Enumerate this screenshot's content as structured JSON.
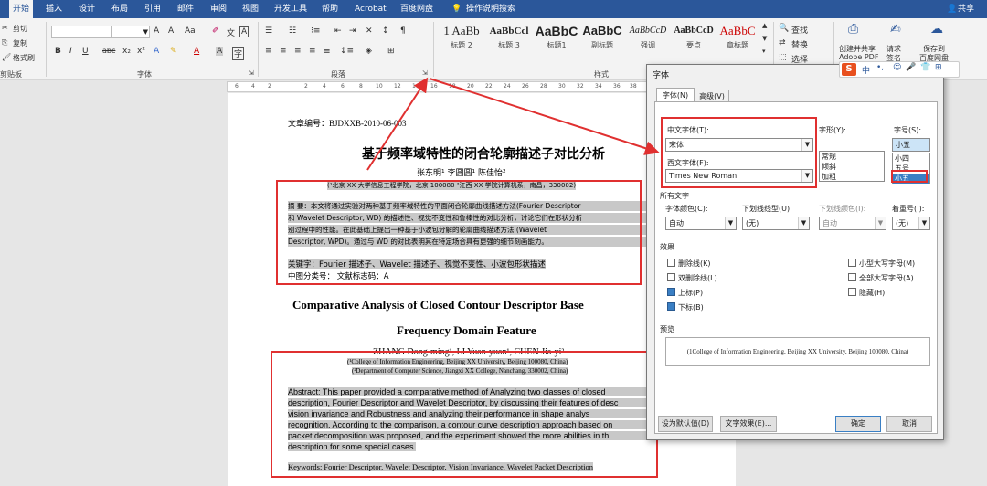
{
  "tabs": [
    "开始",
    "插入",
    "设计",
    "布局",
    "引用",
    "邮件",
    "审阅",
    "视图",
    "开发工具",
    "帮助",
    "Acrobat",
    "百度网盘"
  ],
  "tell_me": "操作说明搜索",
  "share": "共享",
  "clipboard": {
    "cut": "剪切",
    "copy": "复制",
    "format_painter": "格式刷",
    "label": "剪贴板"
  },
  "font_group": {
    "label": "字体",
    "bold": "B",
    "italic": "I",
    "underline": "U",
    "strike": "abc",
    "sub": "x₂",
    "sup": "x²",
    "font_color": "A",
    "clear": "A",
    "case": "Aa",
    "grow": "A",
    "shrink": "A"
  },
  "paragraph_group": {
    "label": "段落"
  },
  "styles_group": {
    "label": "样式",
    "items": [
      {
        "preview": "1 AaBb",
        "name": "标题 2"
      },
      {
        "preview": "AaBbCcl",
        "name": "标题 3"
      },
      {
        "preview": "AaBbC",
        "name": "标题1"
      },
      {
        "preview": "AaBbC",
        "name": "副标题"
      },
      {
        "preview": "AaBbCcD",
        "name": "强调"
      },
      {
        "preview": "AaBbCcD",
        "name": "要点"
      },
      {
        "preview": "AaBbC",
        "name": "章标题"
      }
    ]
  },
  "editing": {
    "find": "查找",
    "replace": "替换",
    "select": "选择"
  },
  "adobe": {
    "create_share": "创建并共享",
    "adobe_pdf": "Adobe PDF",
    "request_sign": "请求",
    "sign": "签名",
    "save_to": "保存到",
    "baidu": "百度网盘"
  },
  "ruler_ticks": [
    "6",
    "4",
    "2",
    "",
    "2",
    "4",
    "6",
    "8",
    "10",
    "12",
    "14",
    "16",
    "18",
    "20",
    "22",
    "24",
    "26",
    "28",
    "30",
    "32",
    "34",
    "36",
    "38",
    "40"
  ],
  "document": {
    "doc_no": "文章编号：BJDXXB-2010-06-003",
    "title_cn": "基于频率域特性的闭合轮廓描述子对比分析",
    "authors_cn": "张东明¹ 李圆圆¹ 陈佳怡²",
    "affil_cn": "(¹北京 XX 大学信息工程学院，北京 100080 ²江西 XX 学院计算机系，南昌，330002)",
    "abstract_cn_1": "摘  要：本文将通过实验对两种基于频率域特性的平面闭合轮廓曲线描述方法(Fourier Descriptor",
    "abstract_cn_2": "和 Wavelet Descriptor, WD) 的描述性、视觉不变性和鲁棒性的对比分析，讨论它们在形状分析",
    "abstract_cn_3": "别过程中的性能。在此基础上提出一种基于小波包分解的轮廓曲线描述方法 (Wavelet",
    "abstract_cn_4": "Descriptor, WPD)。通过与 WD 的对比表明其在特定场合具有更强的细节刻画能力。",
    "keywords_cn": "关键字：Fourier 描述子、Wavelet 描述子、视觉不变性、小波包形状描述",
    "class_cn": "中图分类号：              文献标志码：A",
    "title_en_1": "Comparative Analysis of Closed Contour Descriptor Base",
    "title_en_2": "Frequency Domain Feature",
    "authors_en": "ZHANG Dong-ming¹, LI Yuan-yuan¹, CHEN Jia-yi²",
    "affil_en_1": "(¹College of Information Engineering, Beijing XX University, Beijing 100080, China)",
    "affil_en_2": "(²Department of Computer Science, Jiangxi XX College, Nanchang, 330002, China)",
    "abstract_en_1": "Abstract: This paper provided a comparative method of Analyzing two classes of closed",
    "abstract_en_2": "description, Fourier Descriptor and Wavelet Descriptor, by discussing their features of desc",
    "abstract_en_3": "vision invariance and Robustness and analyzing their performance in shape analys",
    "abstract_en_4": "recognition. According to the comparison, a contour curve description approach based on",
    "abstract_en_5": "packet decomposition was proposed, and the experiment showed the more abilities in th",
    "abstract_en_6": "description for some special cases.",
    "keywords_en": "Keywords: Fourier Descriptor, Wavelet Descriptor, Vision Invariance, Wavelet Packet Description"
  },
  "dialog": {
    "title": "字体",
    "tab_font": "字体(N)",
    "tab_advanced": "高级(V)",
    "chinese_font_label": "中文字体(T):",
    "chinese_font": "宋体",
    "western_font_label": "西文字体(F):",
    "western_font": "Times New Roman",
    "style_label": "字形(Y):",
    "styles": [
      "常规",
      "倾斜",
      "加粗"
    ],
    "size_label": "字号(S):",
    "size_value": "小五",
    "sizes": [
      "小四",
      "五号",
      "小五"
    ],
    "all_text": "所有文字",
    "color_label": "字体颜色(C):",
    "color_value": "自动",
    "underline_label": "下划线线型(U):",
    "underline_value": "(无)",
    "underline_color_label": "下划线颜色(I):",
    "underline_color_value": "自动",
    "emphasis_label": "着重号(·):",
    "emphasis_value": "(无)",
    "effects": "效果",
    "strike": "删除线(K)",
    "double_strike": "双删除线(L)",
    "superscript": "上标(P)",
    "subscript": "下标(B)",
    "small_caps": "小型大写字母(M)",
    "all_caps": "全部大写字母(A)",
    "hidden": "隐藏(H)",
    "checked": {
      "superscript": true,
      "subscript": true
    },
    "preview_label": "预览",
    "preview_text": "(1College of Information Engineering, Beijing XX University, Beijing 100080, China)",
    "set_default": "设为默认值(D)",
    "text_effects": "文字效果(E)...",
    "ok": "确定",
    "cancel": "取消"
  },
  "sogou": {
    "logo": "S",
    "lang": "中",
    "punct": "•,"
  },
  "colors": {
    "word_blue": "#2b579a",
    "annotation_red": "#e03030"
  }
}
